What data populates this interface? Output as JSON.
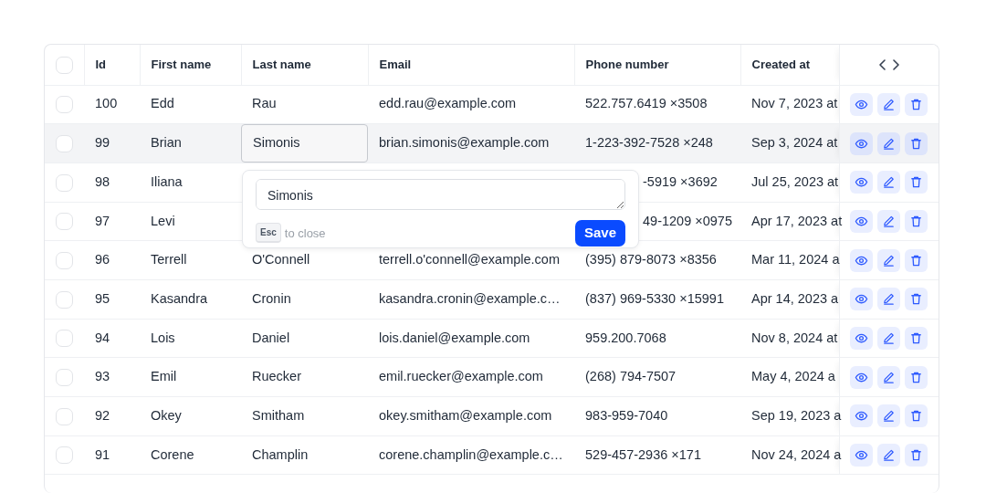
{
  "table": {
    "header_checkbox": {
      "checked": false
    },
    "columns": [
      "Id",
      "First name",
      "Last name",
      "Email",
      "Phone number",
      "Created at"
    ],
    "rows": [
      {
        "id": "100",
        "first_name": "Edd",
        "last_name": "Rau",
        "email": "edd.rau@example.com",
        "phone": "522.757.6419 ×3508",
        "created": "Nov 7, 2023 at",
        "checked": false,
        "highlighted": false,
        "editing": false,
        "covered": false
      },
      {
        "id": "99",
        "first_name": "Brian",
        "last_name": "Simonis",
        "email": "brian.simonis@example.com",
        "phone": "1-223-392-7528 ×248",
        "created": "Sep 3, 2024 at",
        "checked": false,
        "highlighted": true,
        "editing": true,
        "covered": false
      },
      {
        "id": "98",
        "first_name": "Iliana",
        "phone": "-5919 ×3692",
        "created": "Jul 25, 2023 at",
        "checked": false,
        "highlighted": false,
        "editing": false,
        "covered": true
      },
      {
        "id": "97",
        "first_name": "Levi",
        "phone": "49-1209 ×0975",
        "created": "Apr 17, 2023 at",
        "checked": false,
        "highlighted": false,
        "editing": false,
        "covered": true
      },
      {
        "id": "96",
        "first_name": "Terrell",
        "last_name": "O'Connell",
        "email": "terrell.o'connell@example.com",
        "phone": "(395) 879-8073 ×8356",
        "created": "Mar 11, 2024 a",
        "checked": false,
        "highlighted": false,
        "editing": false,
        "covered": false
      },
      {
        "id": "95",
        "first_name": "Kasandra",
        "last_name": "Cronin",
        "email": "kasandra.cronin@example.c…",
        "phone": "(837) 969-5330 ×15991",
        "created": "Apr 14, 2023 a",
        "checked": false,
        "highlighted": false,
        "editing": false,
        "covered": false
      },
      {
        "id": "94",
        "first_name": "Lois",
        "last_name": "Daniel",
        "email": "lois.daniel@example.com",
        "phone": "959.200.7068",
        "created": "Nov 8, 2024 at",
        "checked": false,
        "highlighted": false,
        "editing": false,
        "covered": false
      },
      {
        "id": "93",
        "first_name": "Emil",
        "last_name": "Ruecker",
        "email": "emil.ruecker@example.com",
        "phone": "(268) 794-7507",
        "created": "May 4, 2024 a",
        "checked": false,
        "highlighted": false,
        "editing": false,
        "covered": false
      },
      {
        "id": "92",
        "first_name": "Okey",
        "last_name": "Smitham",
        "email": "okey.smitham@example.com",
        "phone": "983-959-7040",
        "created": "Sep 19, 2023 a",
        "checked": false,
        "highlighted": false,
        "editing": false,
        "covered": false
      },
      {
        "id": "91",
        "first_name": "Corene",
        "last_name": "Champlin",
        "email": "corene.champlin@example.c…",
        "phone": "529-457-2936 ×171",
        "created": "Nov 24, 2024 a",
        "checked": false,
        "highlighted": false,
        "editing": false,
        "covered": false
      }
    ]
  },
  "popover": {
    "value": "Simonis",
    "key": "Esc",
    "hint": "to close",
    "save": "Save"
  }
}
